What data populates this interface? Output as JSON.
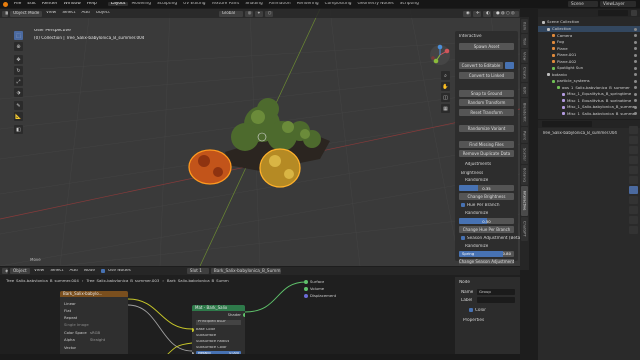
{
  "menubar": {
    "menus": [
      "File",
      "Edit",
      "Render",
      "Window",
      "Help"
    ],
    "workspaces": [
      "Layout",
      "Modeling",
      "Sculpting",
      "UV Editing",
      "Texture Paint",
      "Shading",
      "Animation",
      "Rendering",
      "Compositing",
      "Geometry Nodes",
      "Scripting"
    ],
    "active_workspace": "Layout",
    "scene": "Scene",
    "view_layer": "ViewLayer"
  },
  "viewport": {
    "header": {
      "mode": "Object Mode",
      "menus": [
        "View",
        "Select",
        "Add",
        "Object"
      ],
      "orientation": "Global"
    },
    "overlay_title": "User Perspective",
    "overlay_collection": "(0) Collection | Tree_Salix-babylonica_B_summer.004",
    "footer_hint": "Move"
  },
  "npanel": {
    "title": "Interactive",
    "buttons": {
      "spawn": "Spawn Asset",
      "convert_editable": "Convert to Editable",
      "convert_linked": "Convert to Linked",
      "snap": "Snap to Ground",
      "random_transform": "Random Transform",
      "reset_transform": "Reset Transform",
      "randomize_variant": "Randomize Variant",
      "find_missing": "Find Missing Files",
      "remove_duplicates": "Remove Duplicate Data"
    },
    "adjustments": {
      "title": "Adjustments",
      "brightness_label": "Brightness",
      "randomize1_label": "Randomize",
      "brightness_value": "0.35",
      "change_brightness": "Change Brightness",
      "hue_per_branch": "Hue Per Branch",
      "randomize2_label": "Randomize",
      "hue_value": "0.50",
      "change_hue": "Change Hue Per Branch",
      "season_label": "Season Adjustment (Beta)",
      "randomize3_label": "Randomize",
      "spring_label": "Spring",
      "spring_value": "0.80",
      "change_season": "Change Season Adjustment"
    },
    "brightness_fraction": 0.35,
    "hue_fraction": 0.5,
    "spring_fraction": 0.8
  },
  "sidetabs": [
    "Item",
    "Tool",
    "View",
    "Create",
    "Edit",
    "BlenderKit",
    "Paint",
    "Scatter",
    "Botaniq",
    "Interactive",
    "ChatGPT"
  ],
  "outliner": {
    "title": "Scene Collection",
    "rows": [
      {
        "label": "Collection",
        "indent": 1,
        "color": "#bdbdbd"
      },
      {
        "label": "Camera",
        "indent": 2,
        "color": "#e08a3c"
      },
      {
        "label": "Fog",
        "indent": 2,
        "color": "#e08a3c"
      },
      {
        "label": "Plane",
        "indent": 2,
        "color": "#e08a3c"
      },
      {
        "label": "Plane.001",
        "indent": 2,
        "color": "#e08a3c"
      },
      {
        "label": "Plane.002",
        "indent": 2,
        "color": "#e08a3c"
      },
      {
        "label": "Spotlight Sun",
        "indent": 2,
        "color": "#6fbf55"
      },
      {
        "label": "botaniq",
        "indent": 1,
        "color": "#bdbdbd"
      },
      {
        "label": "particle_systems",
        "indent": 2,
        "color": "#6fbf55"
      },
      {
        "label": "gps_1_Salix-babylonica_B_summer",
        "indent": 3,
        "color": "#6fbf55"
      },
      {
        "label": "Misc_1_Equalitytus_B_springtime",
        "indent": 4,
        "color": "#b29adf"
      },
      {
        "label": "Misc_1_Equalitytus_B_springtime",
        "indent": 4,
        "color": "#b29adf"
      },
      {
        "label": "Misc_1_Salix-babylonica_B_summer",
        "indent": 4,
        "color": "#b29adf"
      },
      {
        "label": "Misc_1_Salix-babylonica_B_summer",
        "indent": 4,
        "color": "#b29adf"
      }
    ]
  },
  "properties": {
    "object_name": "Tree_Salix-babylonica_B_summer.004"
  },
  "node_editor": {
    "header": {
      "menus": [
        "Object",
        "View",
        "Select",
        "Add",
        "Node"
      ],
      "use_nodes": "Use Nodes",
      "slot": "Slot 1",
      "material": "Bark_Salix-babylonica_B_Summ"
    },
    "breadcrumb": [
      "Tree_Salix-babylonica_B_summer.004",
      "Tree_Salix-babylonica_B_summer.003",
      "Bark_Salix-babylonica_B_Summ"
    ],
    "texture_node": {
      "title": "Bark_Salix-babylo...",
      "rows": [
        "Linear",
        "Flat",
        "Repeat",
        "Single Image",
        "Color Space",
        "Alpha",
        "Vector"
      ],
      "color_space_value": "sRGB",
      "alpha_value": "Straight"
    },
    "principled_node": {
      "title": "Mat - Bark_Salix",
      "shader_label": "Shader",
      "bsdf_label": "Principled BSDF",
      "rows": [
        "Base Color",
        "Subsurface",
        "Subsurface Radius",
        "Subsurface Color",
        "Metallic",
        "Specular"
      ],
      "subsurface_value": "0.000",
      "metallic_value": "0.000",
      "specular_value": "0.500"
    },
    "output_node": {
      "rows": [
        "Surface",
        "Volume",
        "Displacement"
      ]
    },
    "side_panel": {
      "title": "Node",
      "name_label": "Name",
      "name_value": "Group",
      "label_label": "Label",
      "color_label": "Color",
      "properties_label": "Properties"
    }
  }
}
